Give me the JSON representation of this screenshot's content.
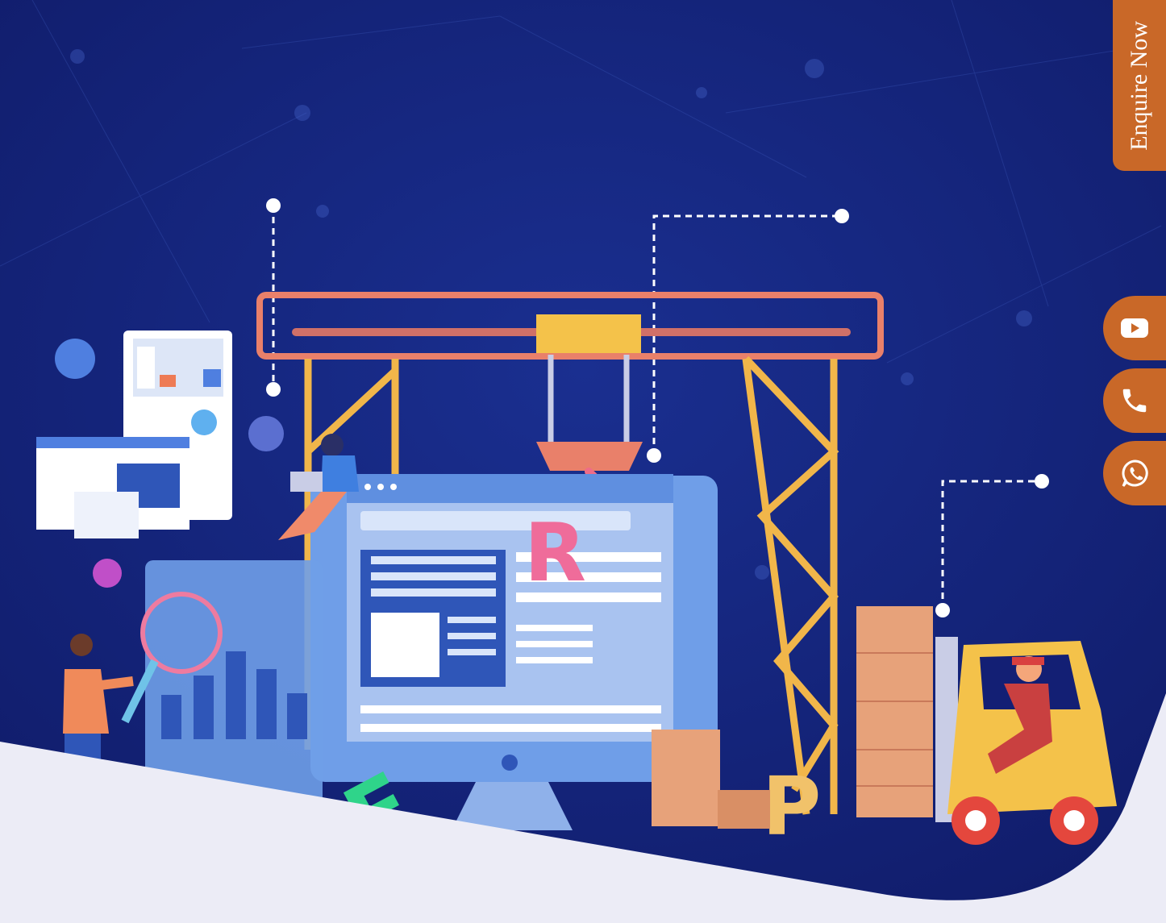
{
  "sidebar": {
    "enquire_label": "Enquire Now",
    "social_links": [
      {
        "icon": "youtube-icon"
      },
      {
        "icon": "phone-icon"
      },
      {
        "icon": "whatsapp-icon"
      }
    ],
    "accent_color": "#c96828"
  },
  "hero": {
    "background_color": "#131f74",
    "footer_shape_color": "#ececf6",
    "scene_letters": [
      "R",
      "E",
      "P"
    ]
  }
}
